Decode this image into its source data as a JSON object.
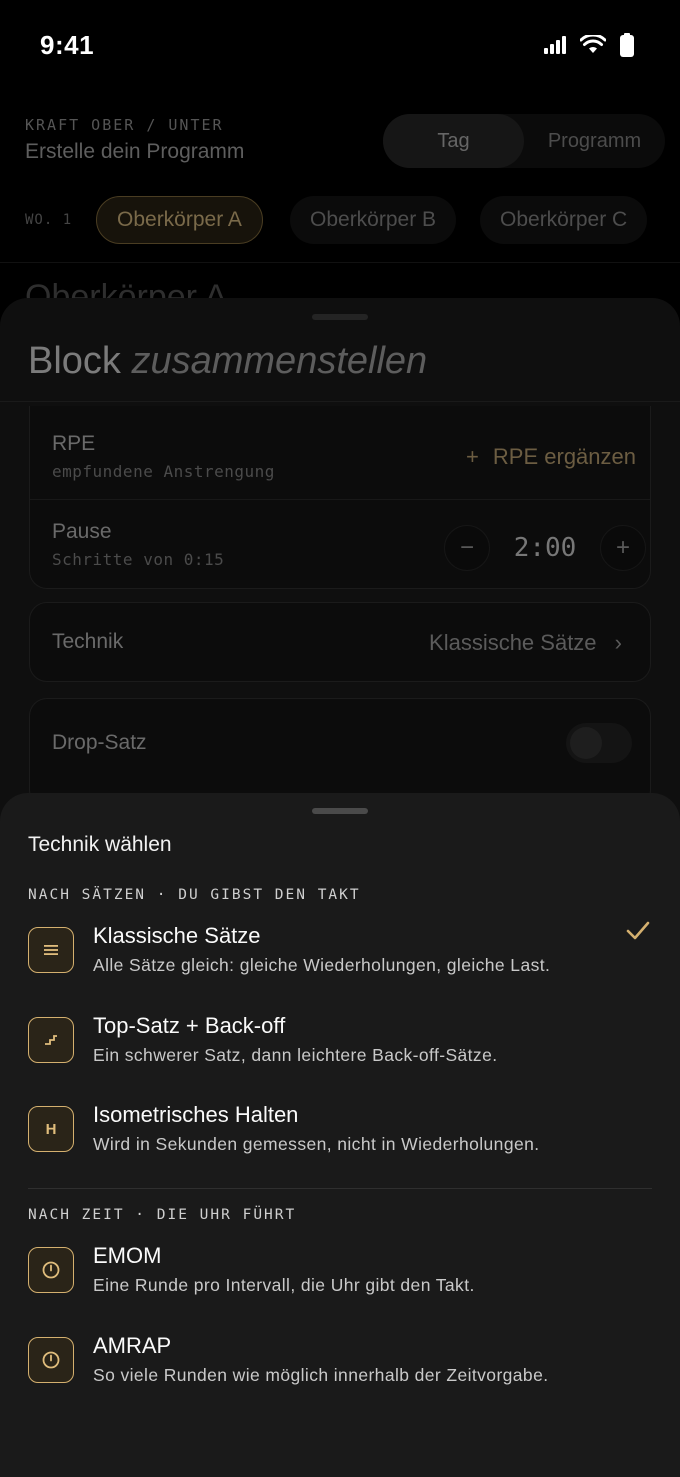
{
  "status": {
    "time": "9:41"
  },
  "header": {
    "eyebrow": "KRAFT OBER / UNTER",
    "title": "Erstelle dein Programm",
    "segments": [
      "Tag",
      "Programm"
    ]
  },
  "days": {
    "week_label": "WO. 1",
    "chips": [
      "Oberkörper A",
      "Oberkörper B",
      "Oberkörper C"
    ]
  },
  "page_peek": "Oberkörper A",
  "block_sheet": {
    "title_plain": "Block",
    "title_italic": "zusammenstellen",
    "rpe_label": "RPE",
    "rpe_sub": "empfundene Anstrengung",
    "rpe_add": "RPE ergänzen",
    "pause_label": "Pause",
    "pause_sub": "Schritte von 0:15",
    "pause_value": "2:00",
    "technik_label": "Technik",
    "technik_value": "Klassische Sätze",
    "drop_label": "Drop-Satz"
  },
  "picker": {
    "title": "Technik wählen",
    "section_sets": "NACH SÄTZEN · DU GIBST DEN TAKT",
    "section_time": "NACH ZEIT · DIE UHR FÜHRT",
    "options": [
      {
        "title": "Klassische Sätze",
        "desc": "Alle Sätze gleich: gleiche Wiederholungen, gleiche Last.",
        "icon": "lines-icon",
        "selected": true
      },
      {
        "title": "Top-Satz + Back-off",
        "desc": "Ein schwerer Satz, dann leichtere Back-off-Sätze.",
        "icon": "step-down-icon",
        "selected": false
      },
      {
        "title": "Isometrisches Halten",
        "desc": "Wird in Sekunden gemessen, nicht in Wiederholungen.",
        "icon": "H",
        "selected": false
      },
      {
        "title": "EMOM",
        "desc": "Eine Runde pro Intervall, die Uhr gibt den Takt.",
        "icon": "clock-icon",
        "selected": false
      },
      {
        "title": "AMRAP",
        "desc": "So viele Runden wie möglich innerhalb der Zeitvorgabe.",
        "icon": "clock-icon",
        "selected": false
      }
    ]
  },
  "colors": {
    "accent": "#d4b06f",
    "sheet": "#1a1a1a",
    "background": "#000000"
  }
}
